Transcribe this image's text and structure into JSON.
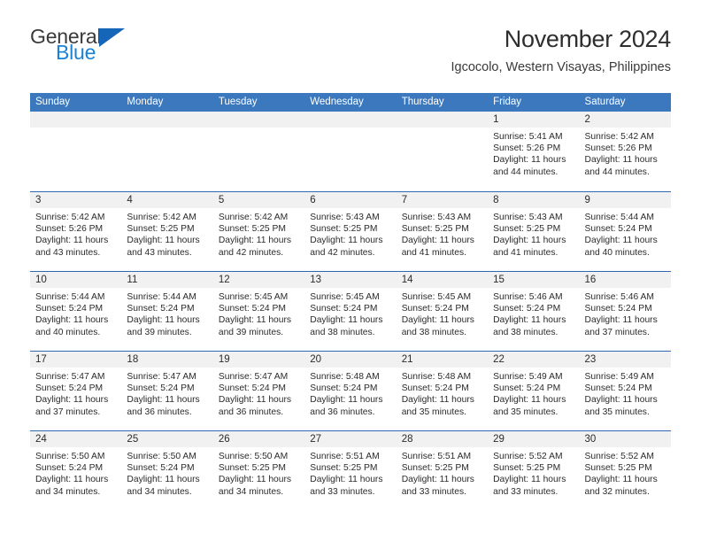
{
  "brand": {
    "name_part1": "General",
    "name_part2": "Blue",
    "triangle_icon": "triangle-icon"
  },
  "header": {
    "title": "November 2024",
    "subtitle": "Igcocolo, Western Visayas, Philippines"
  },
  "colors": {
    "header_blue": "#3c78be",
    "row_divider": "#2f69b0",
    "daynum_band": "#f1f1f1",
    "logo_blue": "#1a82d6",
    "logo_triangle": "#1565b8",
    "text": "#2b2b2b"
  },
  "weekdays": [
    "Sunday",
    "Monday",
    "Tuesday",
    "Wednesday",
    "Thursday",
    "Friday",
    "Saturday"
  ],
  "labels": {
    "sunrise_prefix": "Sunrise:",
    "sunset_prefix": "Sunset:",
    "daylight_prefix": "Daylight:"
  },
  "weeks": [
    [
      {
        "day": "",
        "empty": true
      },
      {
        "day": "",
        "empty": true
      },
      {
        "day": "",
        "empty": true
      },
      {
        "day": "",
        "empty": true
      },
      {
        "day": "",
        "empty": true
      },
      {
        "day": "1",
        "sunrise": "Sunrise: 5:41 AM",
        "sunset": "Sunset: 5:26 PM",
        "daylight": "Daylight: 11 hours and 44 minutes."
      },
      {
        "day": "2",
        "sunrise": "Sunrise: 5:42 AM",
        "sunset": "Sunset: 5:26 PM",
        "daylight": "Daylight: 11 hours and 44 minutes."
      }
    ],
    [
      {
        "day": "3",
        "sunrise": "Sunrise: 5:42 AM",
        "sunset": "Sunset: 5:26 PM",
        "daylight": "Daylight: 11 hours and 43 minutes."
      },
      {
        "day": "4",
        "sunrise": "Sunrise: 5:42 AM",
        "sunset": "Sunset: 5:25 PM",
        "daylight": "Daylight: 11 hours and 43 minutes."
      },
      {
        "day": "5",
        "sunrise": "Sunrise: 5:42 AM",
        "sunset": "Sunset: 5:25 PM",
        "daylight": "Daylight: 11 hours and 42 minutes."
      },
      {
        "day": "6",
        "sunrise": "Sunrise: 5:43 AM",
        "sunset": "Sunset: 5:25 PM",
        "daylight": "Daylight: 11 hours and 42 minutes."
      },
      {
        "day": "7",
        "sunrise": "Sunrise: 5:43 AM",
        "sunset": "Sunset: 5:25 PM",
        "daylight": "Daylight: 11 hours and 41 minutes."
      },
      {
        "day": "8",
        "sunrise": "Sunrise: 5:43 AM",
        "sunset": "Sunset: 5:25 PM",
        "daylight": "Daylight: 11 hours and 41 minutes."
      },
      {
        "day": "9",
        "sunrise": "Sunrise: 5:44 AM",
        "sunset": "Sunset: 5:24 PM",
        "daylight": "Daylight: 11 hours and 40 minutes."
      }
    ],
    [
      {
        "day": "10",
        "sunrise": "Sunrise: 5:44 AM",
        "sunset": "Sunset: 5:24 PM",
        "daylight": "Daylight: 11 hours and 40 minutes."
      },
      {
        "day": "11",
        "sunrise": "Sunrise: 5:44 AM",
        "sunset": "Sunset: 5:24 PM",
        "daylight": "Daylight: 11 hours and 39 minutes."
      },
      {
        "day": "12",
        "sunrise": "Sunrise: 5:45 AM",
        "sunset": "Sunset: 5:24 PM",
        "daylight": "Daylight: 11 hours and 39 minutes."
      },
      {
        "day": "13",
        "sunrise": "Sunrise: 5:45 AM",
        "sunset": "Sunset: 5:24 PM",
        "daylight": "Daylight: 11 hours and 38 minutes."
      },
      {
        "day": "14",
        "sunrise": "Sunrise: 5:45 AM",
        "sunset": "Sunset: 5:24 PM",
        "daylight": "Daylight: 11 hours and 38 minutes."
      },
      {
        "day": "15",
        "sunrise": "Sunrise: 5:46 AM",
        "sunset": "Sunset: 5:24 PM",
        "daylight": "Daylight: 11 hours and 38 minutes."
      },
      {
        "day": "16",
        "sunrise": "Sunrise: 5:46 AM",
        "sunset": "Sunset: 5:24 PM",
        "daylight": "Daylight: 11 hours and 37 minutes."
      }
    ],
    [
      {
        "day": "17",
        "sunrise": "Sunrise: 5:47 AM",
        "sunset": "Sunset: 5:24 PM",
        "daylight": "Daylight: 11 hours and 37 minutes."
      },
      {
        "day": "18",
        "sunrise": "Sunrise: 5:47 AM",
        "sunset": "Sunset: 5:24 PM",
        "daylight": "Daylight: 11 hours and 36 minutes."
      },
      {
        "day": "19",
        "sunrise": "Sunrise: 5:47 AM",
        "sunset": "Sunset: 5:24 PM",
        "daylight": "Daylight: 11 hours and 36 minutes."
      },
      {
        "day": "20",
        "sunrise": "Sunrise: 5:48 AM",
        "sunset": "Sunset: 5:24 PM",
        "daylight": "Daylight: 11 hours and 36 minutes."
      },
      {
        "day": "21",
        "sunrise": "Sunrise: 5:48 AM",
        "sunset": "Sunset: 5:24 PM",
        "daylight": "Daylight: 11 hours and 35 minutes."
      },
      {
        "day": "22",
        "sunrise": "Sunrise: 5:49 AM",
        "sunset": "Sunset: 5:24 PM",
        "daylight": "Daylight: 11 hours and 35 minutes."
      },
      {
        "day": "23",
        "sunrise": "Sunrise: 5:49 AM",
        "sunset": "Sunset: 5:24 PM",
        "daylight": "Daylight: 11 hours and 35 minutes."
      }
    ],
    [
      {
        "day": "24",
        "sunrise": "Sunrise: 5:50 AM",
        "sunset": "Sunset: 5:24 PM",
        "daylight": "Daylight: 11 hours and 34 minutes."
      },
      {
        "day": "25",
        "sunrise": "Sunrise: 5:50 AM",
        "sunset": "Sunset: 5:24 PM",
        "daylight": "Daylight: 11 hours and 34 minutes."
      },
      {
        "day": "26",
        "sunrise": "Sunrise: 5:50 AM",
        "sunset": "Sunset: 5:25 PM",
        "daylight": "Daylight: 11 hours and 34 minutes."
      },
      {
        "day": "27",
        "sunrise": "Sunrise: 5:51 AM",
        "sunset": "Sunset: 5:25 PM",
        "daylight": "Daylight: 11 hours and 33 minutes."
      },
      {
        "day": "28",
        "sunrise": "Sunrise: 5:51 AM",
        "sunset": "Sunset: 5:25 PM",
        "daylight": "Daylight: 11 hours and 33 minutes."
      },
      {
        "day": "29",
        "sunrise": "Sunrise: 5:52 AM",
        "sunset": "Sunset: 5:25 PM",
        "daylight": "Daylight: 11 hours and 33 minutes."
      },
      {
        "day": "30",
        "sunrise": "Sunrise: 5:52 AM",
        "sunset": "Sunset: 5:25 PM",
        "daylight": "Daylight: 11 hours and 32 minutes."
      }
    ]
  ]
}
